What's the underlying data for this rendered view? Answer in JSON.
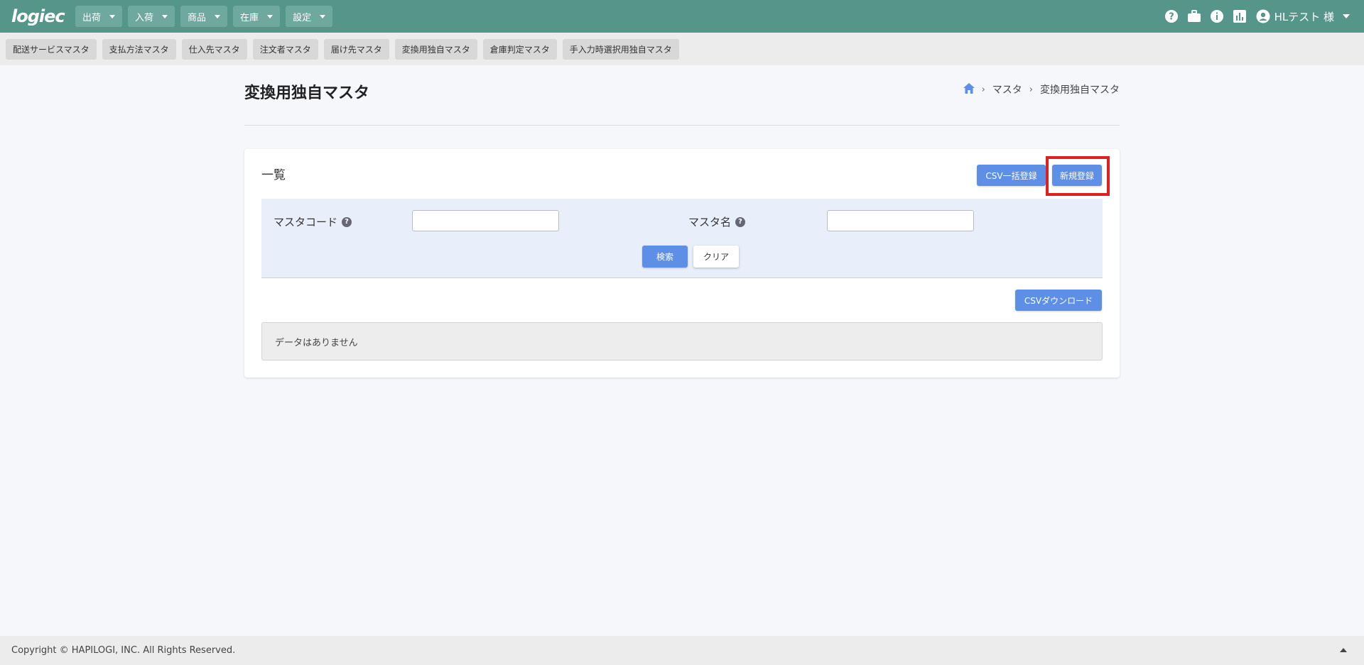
{
  "header": {
    "logo_text": "logiec",
    "nav": [
      {
        "label": "出荷"
      },
      {
        "label": "入荷"
      },
      {
        "label": "商品"
      },
      {
        "label": "在庫"
      },
      {
        "label": "設定"
      }
    ],
    "user_label": "HLテスト 様",
    "icons": [
      "help-icon",
      "briefcase-icon",
      "info-icon",
      "chart-icon",
      "account-icon"
    ]
  },
  "submenu": [
    {
      "label": "配送サービスマスタ"
    },
    {
      "label": "支払方法マスタ"
    },
    {
      "label": "仕入先マスタ"
    },
    {
      "label": "注文者マスタ"
    },
    {
      "label": "届け先マスタ"
    },
    {
      "label": "変換用独自マスタ"
    },
    {
      "label": "倉庫判定マスタ"
    },
    {
      "label": "手入力時選択用独自マスタ"
    }
  ],
  "page": {
    "title": "変換用独自マスタ",
    "breadcrumb": [
      {
        "label": "マスタ"
      },
      {
        "label": "変換用独自マスタ"
      }
    ]
  },
  "card": {
    "title": "一覧",
    "csv_bulk_label": "CSV一括登録",
    "new_label": "新規登録",
    "search": {
      "code_label": "マスタコード",
      "code_value": "",
      "name_label": "マスタ名",
      "name_value": "",
      "help_glyph": "?",
      "search_label": "検索",
      "clear_label": "クリア"
    },
    "csv_download_label": "CSVダウンロード",
    "empty_message": "データはありません"
  },
  "footer": {
    "copyright": "Copyright © HAPILOGI, INC. All Rights Reserved."
  },
  "colors": {
    "header_bg": "#56958a",
    "primary_button": "#5e8fe6",
    "highlight": "#e02020"
  }
}
